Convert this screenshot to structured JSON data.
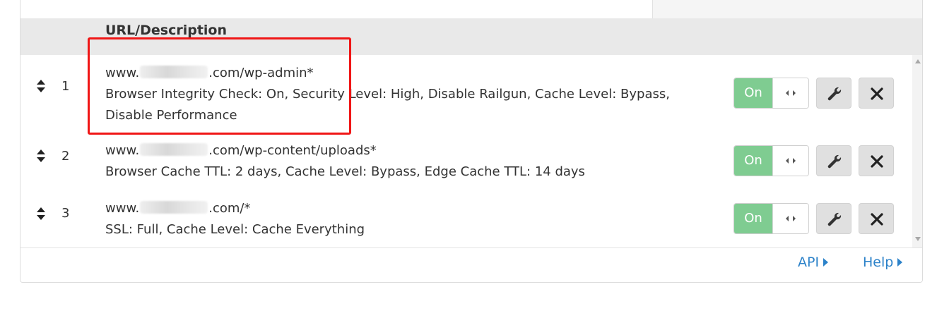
{
  "table": {
    "column_header": "URL/Description",
    "rows": [
      {
        "index": "1",
        "url_prefix": "www.",
        "url_suffix": ".com/wp-admin*",
        "description": "Browser Integrity Check: On, Security Level: High, Disable Railgun, Cache Level: Bypass, Disable Performance",
        "toggle_label": "On"
      },
      {
        "index": "2",
        "url_prefix": "www.",
        "url_suffix": ".com/wp-content/uploads*",
        "description": "Browser Cache TTL: 2 days, Cache Level: Bypass, Edge Cache TTL: 14 days",
        "toggle_label": "On"
      },
      {
        "index": "3",
        "url_prefix": "www.",
        "url_suffix": ".com/*",
        "description": "SSL: Full, Cache Level: Cache Everything",
        "toggle_label": "On"
      }
    ]
  },
  "footer": {
    "api_label": "API",
    "help_label": "Help"
  },
  "icons": {
    "sort": "sort-handle-icon",
    "toggle_handle": "drag-arrows-icon",
    "edit": "wrench-icon",
    "delete": "close-icon"
  },
  "colors": {
    "toggle_on": "#7fcc91",
    "link": "#2c82c9",
    "highlight": "#f01616",
    "header_bg": "#e9e9e9"
  }
}
